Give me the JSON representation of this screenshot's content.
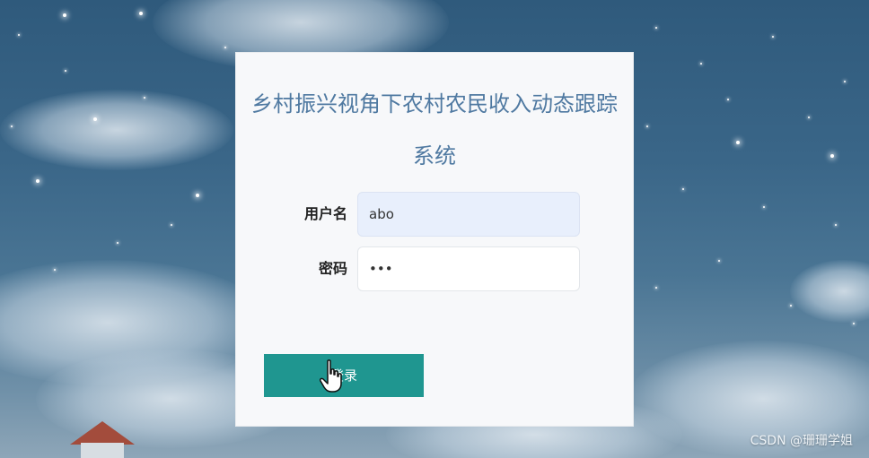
{
  "login": {
    "title": "乡村振兴视角下农村农民收入动态跟踪系统",
    "username_label": "用户名",
    "username_value": "abo",
    "password_label": "密码",
    "password_masked": "•••",
    "submit_label": "登录"
  },
  "watermark": "CSDN @珊珊学姐",
  "colors": {
    "title": "#4f79a1",
    "button": "#1f9690",
    "card": "#f7f8fa",
    "username_field_bg": "#e8effc"
  },
  "icons": [
    "hand-pointer-cursor-icon"
  ]
}
